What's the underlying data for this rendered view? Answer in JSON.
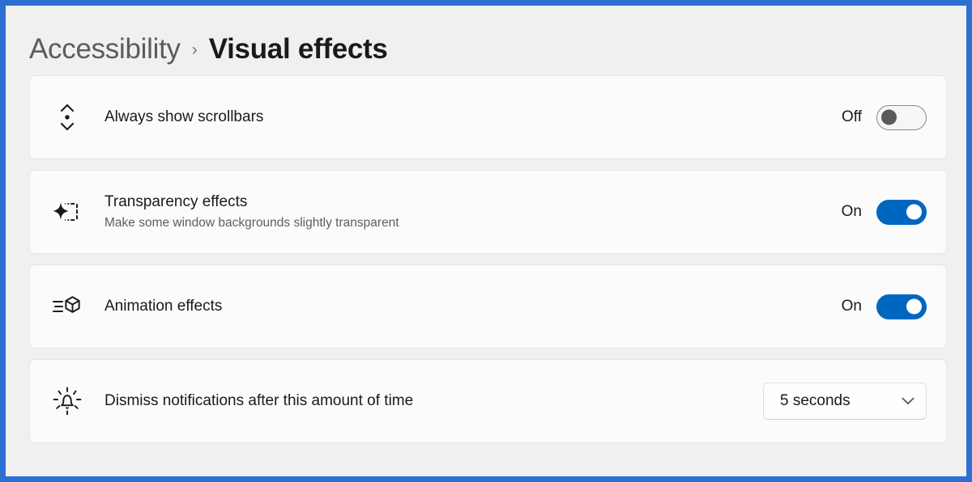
{
  "window": {
    "accent_color": "#2C6FD1",
    "page_background": "#F0F0F0",
    "card_background": "#FBFBFB"
  },
  "breadcrumb": {
    "parent": "Accessibility",
    "separator": "›",
    "current": "Visual effects"
  },
  "settings": [
    {
      "id": "always-show-scrollbars",
      "icon": "scrollbar-icon",
      "title": "Always show scrollbars",
      "subtitle": "",
      "control": "toggle",
      "state_label": "Off",
      "state": "off"
    },
    {
      "id": "transparency-effects",
      "icon": "transparency-icon",
      "title": "Transparency effects",
      "subtitle": "Make some window backgrounds slightly transparent",
      "control": "toggle",
      "state_label": "On",
      "state": "on"
    },
    {
      "id": "animation-effects",
      "icon": "animation-icon",
      "title": "Animation effects",
      "subtitle": "",
      "control": "toggle",
      "state_label": "On",
      "state": "on"
    },
    {
      "id": "dismiss-notifications",
      "icon": "notification-bell-icon",
      "title": "Dismiss notifications after this amount of time",
      "subtitle": "",
      "control": "dropdown",
      "state_label": "5 seconds",
      "state": "5 seconds"
    }
  ],
  "colors": {
    "toggle_on": "#0067C0",
    "toggle_off_knob": "#5A5A5A",
    "title_text": "#1A1A1A",
    "subtitle_text": "#5E5E5E",
    "breadcrumb_parent": "#5C5C5C"
  }
}
